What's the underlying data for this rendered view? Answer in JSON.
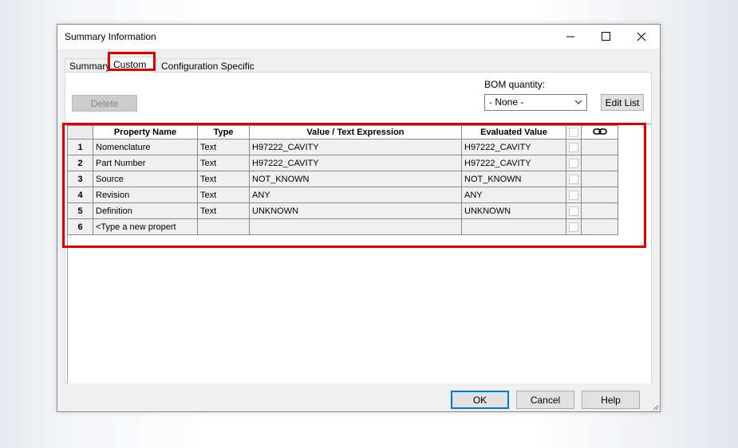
{
  "window": {
    "title": "Summary Information"
  },
  "tabs": [
    {
      "label": "Summary"
    },
    {
      "label": "Custom"
    },
    {
      "label": "Configuration Specific"
    }
  ],
  "toolbar": {
    "delete_label": "Delete",
    "bom_label": "BOM quantity:",
    "bom_value": "- None -",
    "edit_list_label": "Edit List"
  },
  "table": {
    "headers": [
      "Property Name",
      "Type",
      "Value / Text Expression",
      "Evaluated Value"
    ],
    "link_icon": "link-icon",
    "rows": [
      {
        "num": "1",
        "name": "Nomenclature",
        "type": "Text",
        "value": "H97222_CAVITY",
        "evaluated": "H97222_CAVITY"
      },
      {
        "num": "2",
        "name": "Part Number",
        "type": "Text",
        "value": "H97222_CAVITY",
        "evaluated": "H97222_CAVITY"
      },
      {
        "num": "3",
        "name": "Source",
        "type": "Text",
        "value": "NOT_KNOWN",
        "evaluated": "NOT_KNOWN"
      },
      {
        "num": "4",
        "name": "Revision",
        "type": "Text",
        "value": "ANY",
        "evaluated": "ANY"
      },
      {
        "num": "5",
        "name": "Definition",
        "type": "Text",
        "value": "UNKNOWN",
        "evaluated": "UNKNOWN"
      },
      {
        "num": "6",
        "name": "<Type a new propert",
        "type": "",
        "value": "",
        "evaluated": ""
      }
    ]
  },
  "footer": {
    "ok_label": "OK",
    "cancel_label": "Cancel",
    "help_label": "Help"
  },
  "colors": {
    "highlight": "#e00000",
    "ok_border": "#0078d7"
  }
}
